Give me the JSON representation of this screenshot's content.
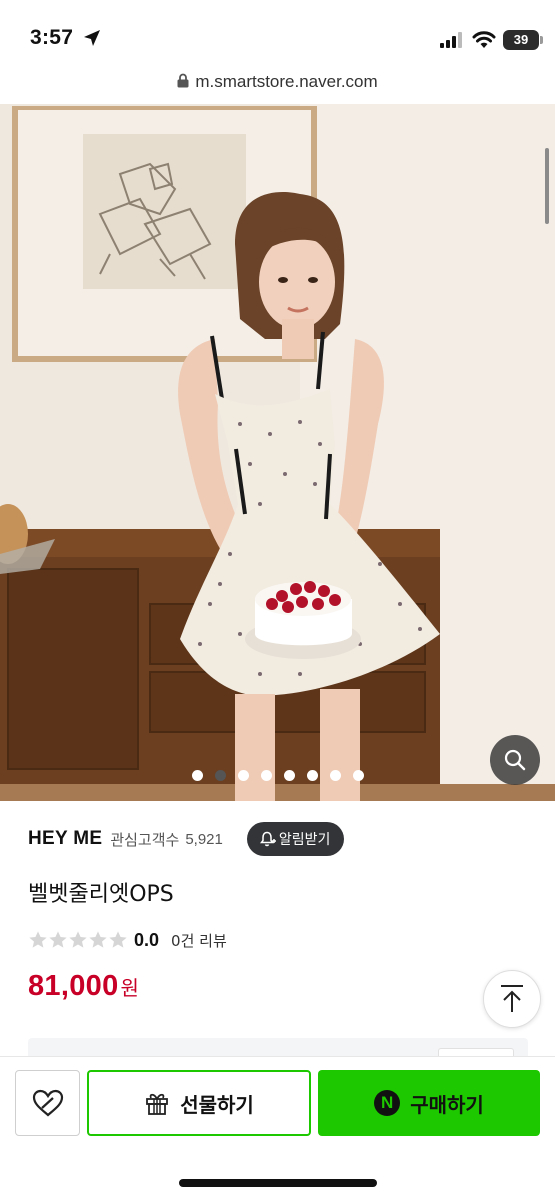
{
  "status_bar": {
    "time": "3:57",
    "battery": "39",
    "battery_level": 0.39,
    "icons": [
      "location-arrow-icon",
      "cellular-signal-icon",
      "wifi-icon",
      "battery-icon"
    ]
  },
  "browser": {
    "url": "m.smartstore.naver.com",
    "icons": [
      "lock-icon"
    ]
  },
  "gallery": {
    "image_count": 8,
    "active_index": 1,
    "icons": [
      "zoom-search-icon"
    ]
  },
  "product": {
    "store_name": "HEY ME",
    "favorite_label": "관심고객수",
    "favorite_count": "5,921",
    "alarm_label": "알림받기",
    "name": "벨벳줄리엣OPS",
    "rating_value": "0.0",
    "rating_stars": 0,
    "review_label": "0건 리뷰",
    "price": "81,000",
    "currency": "원"
  },
  "bottom_bar": {
    "gift_label": "선물하기",
    "buy_label": "구매하기",
    "npay_letter": "N",
    "icons": [
      "heart-icon",
      "gift-icon",
      "naver-pay-icon",
      "scroll-top-icon"
    ]
  },
  "colors": {
    "naver_green": "#1ec800",
    "price_red": "#c80027",
    "alarm_button": "#323437"
  }
}
